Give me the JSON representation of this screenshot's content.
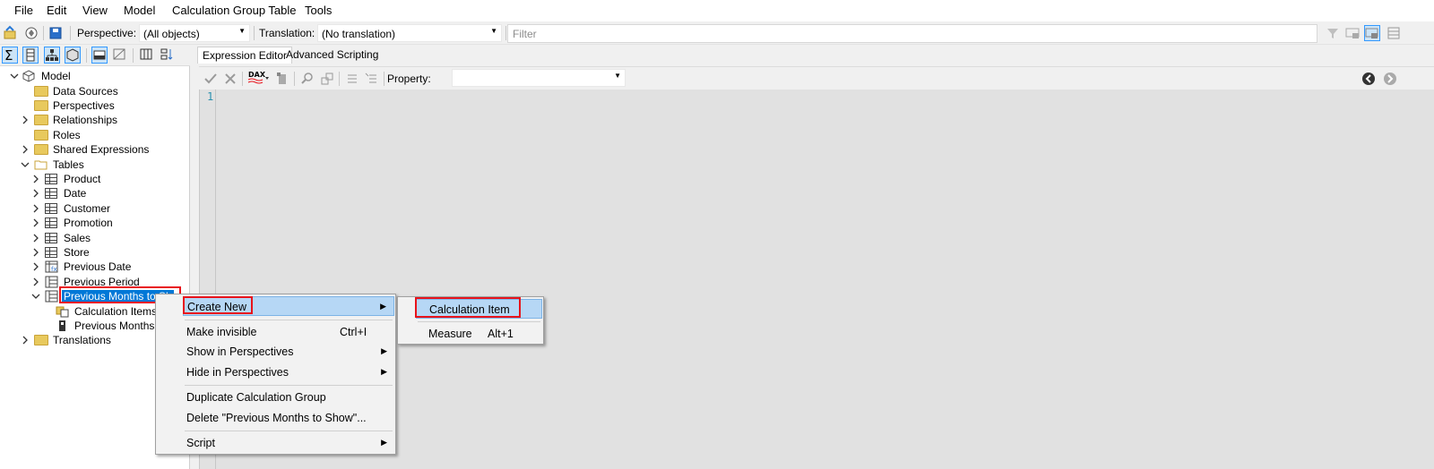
{
  "menubar": {
    "items": [
      "File",
      "Edit",
      "View",
      "Model",
      "Calculation Group Table",
      "Tools"
    ]
  },
  "toolbar": {
    "perspective_label": "Perspective:",
    "perspective_value": "(All objects)",
    "translation_label": "Translation:",
    "translation_value": "(No translation)",
    "filter_placeholder": "Filter"
  },
  "tree": {
    "root": "Model",
    "data_sources": "Data Sources",
    "perspectives": "Perspectives",
    "relationships": "Relationships",
    "roles": "Roles",
    "shared_expressions": "Shared Expressions",
    "tables": "Tables",
    "table_items": [
      "Product",
      "Date",
      "Customer",
      "Promotion",
      "Sales",
      "Store",
      "Previous Date",
      "Previous Period"
    ],
    "selected_table": "Previous Months to Show",
    "selected_table_visible": "Previous Months to Sh",
    "calc_items": "Calculation Items",
    "calc_column": "Previous Months to",
    "translations": "Translations"
  },
  "editor": {
    "tab_expression": "Expression Editor",
    "tab_advanced": "Advanced Scripting",
    "dax_label": "DAX",
    "property_label": "Property:",
    "property_value": "",
    "line_number": "1"
  },
  "context_menu": {
    "create_new": "Create New",
    "make_invisible": "Make invisible",
    "make_invisible_shortcut": "Ctrl+I",
    "show_in_perspectives": "Show in Perspectives",
    "hide_in_perspectives": "Hide in Perspectives",
    "duplicate": "Duplicate Calculation Group",
    "delete": "Delete \"Previous Months to Show\"...",
    "script": "Script"
  },
  "submenu": {
    "calculation_item": "Calculation Item",
    "measure": "Measure",
    "measure_shortcut": "Alt+1"
  },
  "colors": {
    "selection": "#0078d7",
    "highlight": "#b6d7f5",
    "annotation_red": "#e8131b",
    "editor_bg": "#e1e1e1"
  }
}
